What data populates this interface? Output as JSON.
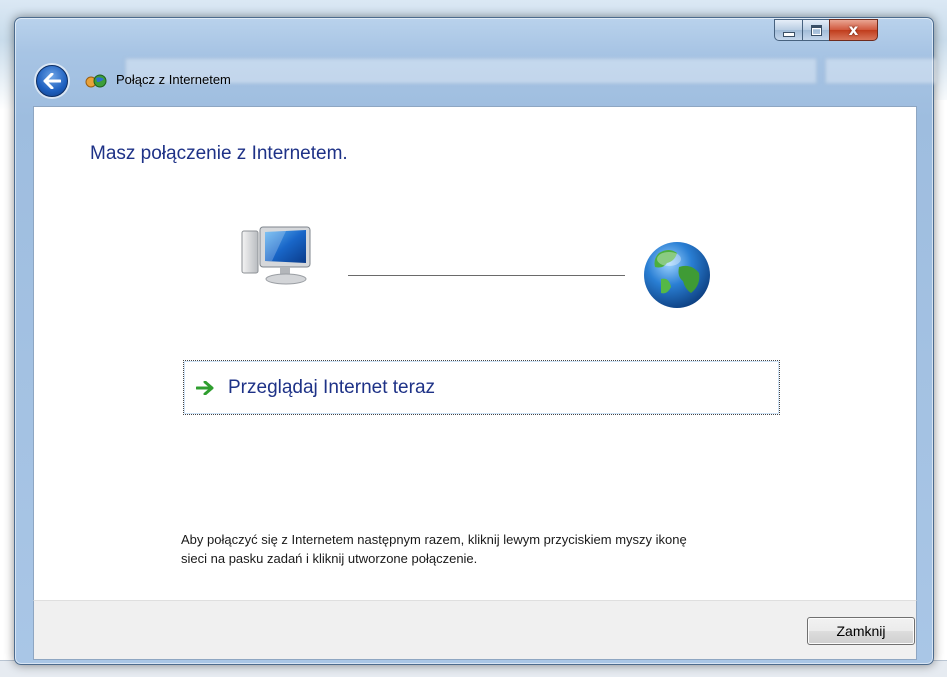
{
  "window": {
    "title": "Połącz z Internetem",
    "caption_buttons": {
      "minimize": "minimize",
      "maximize": "maximize",
      "close": "x"
    }
  },
  "main": {
    "heading": "Masz połączenie z Internetem.",
    "diagram": {
      "left_icon": "computer-icon",
      "right_icon": "globe-icon"
    },
    "browse_link_label": "Przeglądaj Internet teraz",
    "info_text": "Aby połączyć się z Internetem następnym razem, kliknij lewym przyciskiem myszy ikonę sieci na pasku zadań i kliknij utworzone połączenie."
  },
  "footer": {
    "close_button_label": "Zamknij"
  },
  "colors": {
    "heading": "#1e3287",
    "frame": "#a7c4e4",
    "close_caption": "#c03c1c"
  }
}
